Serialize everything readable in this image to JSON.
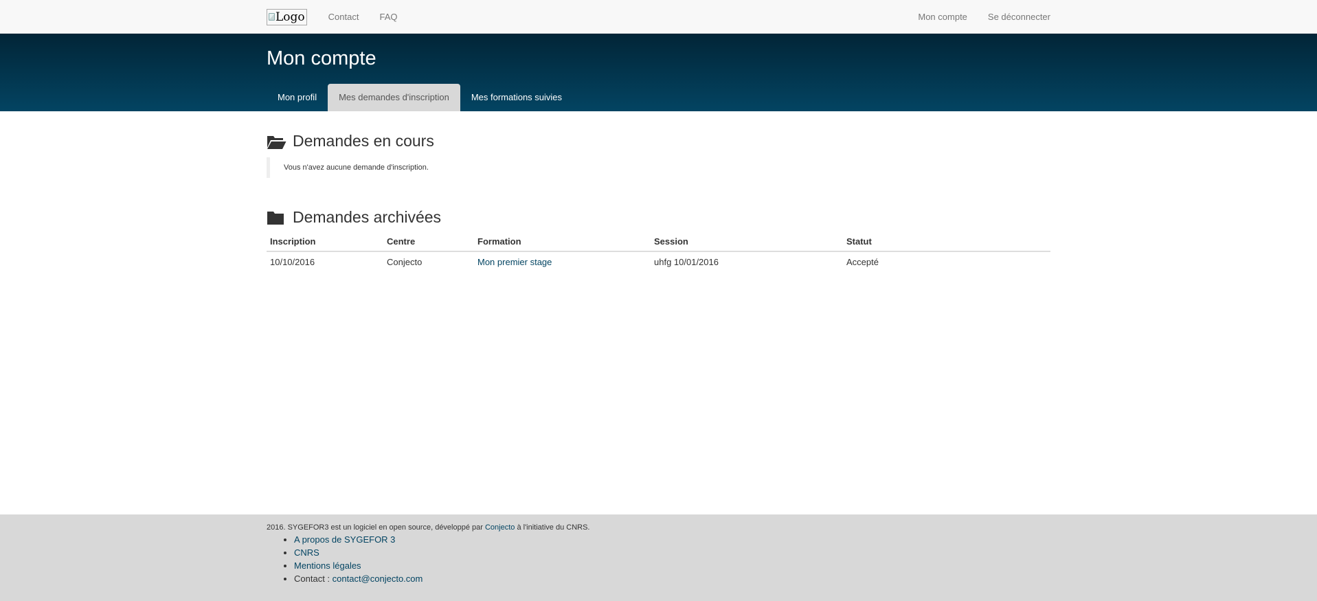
{
  "navbar": {
    "logo_alt": "Logo",
    "left_links": [
      "Contact",
      "FAQ"
    ],
    "right_links": [
      "Mon compte",
      "Se déconnecter"
    ]
  },
  "header": {
    "title": "Mon compte",
    "tabs": [
      {
        "label": "Mon profil",
        "active": false
      },
      {
        "label": "Mes demandes d'inscription",
        "active": true
      },
      {
        "label": "Mes formations suivies",
        "active": false
      }
    ]
  },
  "current_requests": {
    "title": "Demandes en cours",
    "icon": "folder-open-icon",
    "empty_message": "Vous n'avez aucune demande d'inscription."
  },
  "archived_requests": {
    "title": "Demandes archivées",
    "icon": "folder-icon",
    "columns": [
      "Inscription",
      "Centre",
      "Formation",
      "Session",
      "Statut"
    ],
    "rows": [
      {
        "inscription": "10/10/2016",
        "centre": "Conjecto",
        "formation": "Mon premier stage",
        "session": "uhfg 10/01/2016",
        "statut": "Accepté"
      }
    ]
  },
  "footer": {
    "text_prefix": "2016. SYGEFOR3 est un logiciel en open source, développé par ",
    "text_link": "Conjecto",
    "text_suffix": " à l'initiative du CNRS.",
    "links": [
      "A propos de SYGEFOR 3",
      "CNRS",
      "Mentions légales"
    ],
    "contact_label": "Contact : ",
    "contact_email": "contact@conjecto.com"
  },
  "colors": {
    "banner_top": "#022537",
    "banner_bottom": "#034462",
    "link": "#034462",
    "footer_bg": "#d8d8d8"
  }
}
